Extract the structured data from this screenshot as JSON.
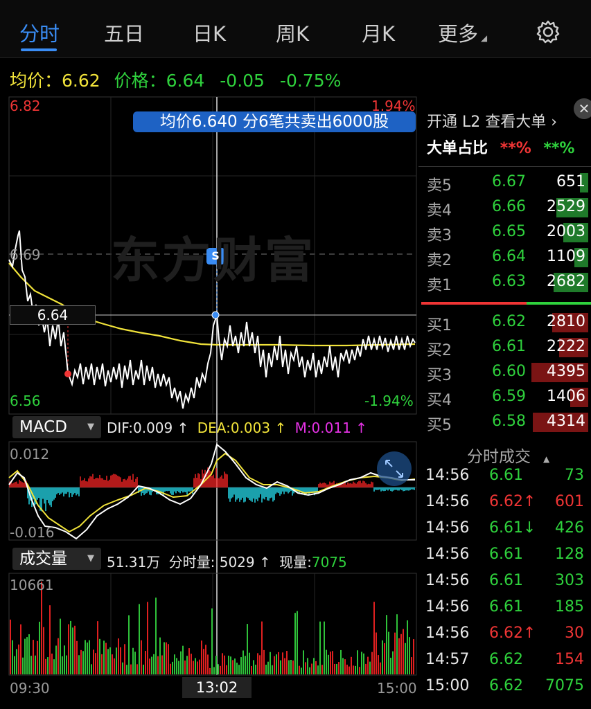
{
  "tabs": [
    "分时",
    "五日",
    "日K",
    "周K",
    "月K",
    "更多"
  ],
  "price_info": {
    "avg_label": "均价：",
    "avg": "6.62",
    "price_label": "价格：",
    "price": "6.64",
    "change": "-0.05",
    "pct": "-0.75%"
  },
  "chart": {
    "y_max": "6.82",
    "y_min": "6.56",
    "y_mid": "6.69",
    "pct_max": "1.94%",
    "pct_min": "-1.94%",
    "cursor_price": "6.64",
    "tooltip": "均价6.640  分6笔共卖出6000股",
    "s_marker": "S",
    "watermark": "东方财富",
    "time_start": "09:30",
    "time_cursor": "13:02",
    "time_end": "15:00"
  },
  "macd": {
    "name": "MACD",
    "dif": "DIF:0.009 ↑",
    "dea": "DEA:0.003 ↑",
    "m": "M:0.011 ↑",
    "max": "0.012",
    "min": "-0.016"
  },
  "volume": {
    "name": "成交量",
    "total": "51.31万",
    "minute": "分时量: 5029 ↑",
    "now_label": "现量:",
    "now": "7075",
    "max": "10661"
  },
  "colors": {
    "accent": "#3a8df5",
    "up": "#f03535",
    "down": "#2fd23d",
    "avg_line": "#f1e33a"
  },
  "orderbook": {
    "title": "开通 L2 查看大单 ›",
    "big_label": "大单占比",
    "big_buy": "**%",
    "big_sell": "**%",
    "asks": [
      {
        "name": "卖5",
        "price": "6.67",
        "vol": "651"
      },
      {
        "name": "卖4",
        "price": "6.66",
        "vol": "2529"
      },
      {
        "name": "卖3",
        "price": "6.65",
        "vol": "2003"
      },
      {
        "name": "卖2",
        "price": "6.64",
        "vol": "1109"
      },
      {
        "name": "卖1",
        "price": "6.63",
        "vol": "2682"
      }
    ],
    "bids": [
      {
        "name": "买1",
        "price": "6.62",
        "vol": "2810"
      },
      {
        "name": "买2",
        "price": "6.61",
        "vol": "2222"
      },
      {
        "name": "买3",
        "price": "6.60",
        "vol": "4395"
      },
      {
        "name": "买4",
        "price": "6.59",
        "vol": "1406"
      },
      {
        "name": "买5",
        "price": "6.58",
        "vol": "4314"
      }
    ]
  },
  "trades": {
    "title": "分时成交",
    "rows": [
      {
        "time": "14:56",
        "price": "6.61",
        "vol": "73",
        "dir": "g"
      },
      {
        "time": "14:56",
        "price": "6.62↑",
        "vol": "601",
        "dir": "r"
      },
      {
        "time": "14:56",
        "price": "6.61↓",
        "vol": "426",
        "dir": "g"
      },
      {
        "time": "14:56",
        "price": "6.61",
        "vol": "128",
        "dir": "g"
      },
      {
        "time": "14:56",
        "price": "6.61",
        "vol": "303",
        "dir": "g"
      },
      {
        "time": "14:56",
        "price": "6.61",
        "vol": "185",
        "dir": "g"
      },
      {
        "time": "14:56",
        "price": "6.62↑",
        "vol": "30",
        "dir": "r"
      },
      {
        "time": "14:57",
        "price": "6.62",
        "vol": "154",
        "dir": "r"
      },
      {
        "time": "15:00",
        "price": "6.62",
        "vol": "7075",
        "dir": "g"
      }
    ]
  }
}
